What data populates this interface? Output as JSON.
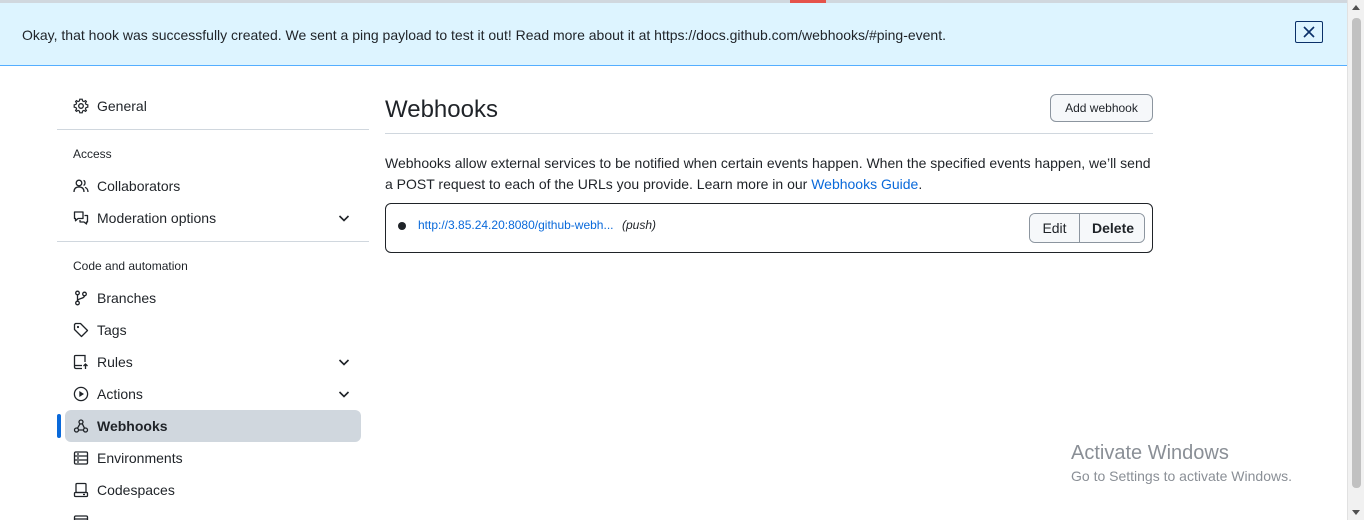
{
  "flash": {
    "message": "Okay, that hook was successfully created. We sent a ping payload to test it out! Read more about it at https://docs.github.com/webhooks/#ping-event."
  },
  "sidebar": {
    "general": "General",
    "access_heading": "Access",
    "collaborators": "Collaborators",
    "moderation": "Moderation options",
    "code_heading": "Code and automation",
    "branches": "Branches",
    "tags": "Tags",
    "rules": "Rules",
    "actions": "Actions",
    "webhooks": "Webhooks",
    "environments": "Environments",
    "codespaces": "Codespaces"
  },
  "main": {
    "title": "Webhooks",
    "add_button": "Add webhook",
    "description": "Webhooks allow external services to be notified when certain events happen. When the specified events happen, we’ll send a POST request to each of the URLs you provide. Learn more in our ",
    "guide_link": "Webhooks Guide",
    "description_end": ".",
    "hooks": [
      {
        "url": "http://3.85.24.20:8080/github-webh...",
        "event": "(push)",
        "edit_label": "Edit",
        "delete_label": "Delete"
      }
    ]
  },
  "watermark": {
    "title": "Activate Windows",
    "subtitle": "Go to Settings to activate Windows."
  },
  "colors": {
    "flash_bg": "#ddf4ff",
    "flash_border": "#54aeff",
    "link": "#0969da",
    "active_bar": "#0969da",
    "active_bg": "#d0d7de"
  },
  "icons": [
    "gear-icon",
    "person-icon",
    "comment-discussion-icon",
    "git-branch-icon",
    "tag-icon",
    "repo-push-icon",
    "play-icon",
    "webhook-icon",
    "server-icon",
    "codespaces-icon",
    "chevron-down-icon",
    "close-icon"
  ]
}
